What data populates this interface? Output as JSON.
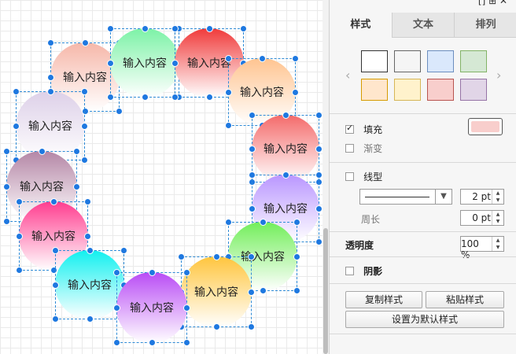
{
  "canvas": {
    "shapes": [
      {
        "label": "输入内容",
        "gradient_top": "#f6b7a9",
        "gradient_bottom": "#ffffff"
      },
      {
        "label": "输入内容",
        "gradient_top": "#7cf2a6",
        "gradient_bottom": "#ffffff"
      },
      {
        "label": "输入内容",
        "gradient_top": "#f03a3a",
        "gradient_bottom": "#ffffff"
      },
      {
        "label": "输入内容",
        "gradient_top": "#ffc490",
        "gradient_bottom": "#ffffff"
      },
      {
        "label": "输入内容",
        "gradient_top": "#ddd0e8",
        "gradient_bottom": "#ffffff"
      },
      {
        "label": "输入内容",
        "gradient_top": "#f46a6a",
        "gradient_bottom": "#ffffff"
      },
      {
        "label": "输入内容",
        "gradient_top": "#b486a6",
        "gradient_bottom": "#ffffff"
      },
      {
        "label": "输入内容",
        "gradient_top": "#b996ff",
        "gradient_bottom": "#ffffff"
      },
      {
        "label": "输入内容",
        "gradient_top": "#ff3d8f",
        "gradient_bottom": "#ffffff"
      },
      {
        "label": "输入内容",
        "gradient_top": "#72ee5a",
        "gradient_bottom": "#ffffff"
      },
      {
        "label": "输入内容",
        "gradient_top": "#11f0ef",
        "gradient_bottom": "#ffffff"
      },
      {
        "label": "输入内容",
        "gradient_top": "#ffc53d",
        "gradient_bottom": "#ffffff"
      },
      {
        "label": "输入内容",
        "gradient_top": "#b94cf5",
        "gradient_bottom": "#ffffff"
      }
    ]
  },
  "panel": {
    "tabs": [
      {
        "label": "样式"
      },
      {
        "label": "文本"
      },
      {
        "label": "排列"
      }
    ],
    "active_tab": "样式",
    "swatches": [
      {
        "name": "white",
        "fill": "#ffffff",
        "border": "#333333"
      },
      {
        "name": "gray",
        "fill": "#f5f5f5",
        "border": "#666666"
      },
      {
        "name": "blue",
        "fill": "#dae8fc",
        "border": "#6c8ebf"
      },
      {
        "name": "green",
        "fill": "#d5e8d4",
        "border": "#82b366"
      },
      {
        "name": "orange",
        "fill": "#ffe6cc",
        "border": "#d79b00"
      },
      {
        "name": "yellow",
        "fill": "#fff2cc",
        "border": "#d6b656"
      },
      {
        "name": "red",
        "fill": "#f8cecc",
        "border": "#b85450"
      },
      {
        "name": "purple",
        "fill": "#e1d5e7",
        "border": "#9673a6"
      }
    ],
    "fill": {
      "label": "填充",
      "checked": true,
      "color": "#f8cecc"
    },
    "gradient": {
      "label": "渐变",
      "checked": false
    },
    "line": {
      "label": "线型",
      "checked": false,
      "width_value": "2 pt"
    },
    "perimeter": {
      "label": "周长",
      "value": "0 pt"
    },
    "opacity": {
      "label": "透明度",
      "value": "100 %"
    },
    "shadow": {
      "label": "阴影",
      "checked": false
    },
    "buttons": {
      "copy_style": "复制样式",
      "paste_style": "粘贴样式",
      "set_default": "设置为默认样式"
    }
  }
}
